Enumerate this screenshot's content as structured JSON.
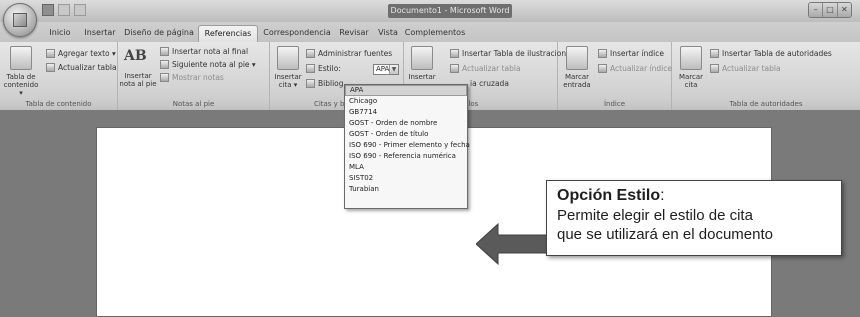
{
  "window": {
    "title": "Documento1 - Microsoft Word",
    "controls": [
      "–",
      "□",
      "✕"
    ]
  },
  "tabs": [
    {
      "label": "Inicio",
      "active": false
    },
    {
      "label": "Insertar",
      "active": false
    },
    {
      "label": "Diseño de página",
      "active": false
    },
    {
      "label": "Referencias",
      "active": true
    },
    {
      "label": "Correspondencia",
      "active": false
    },
    {
      "label": "Revisar",
      "active": false
    },
    {
      "label": "Vista",
      "active": false
    },
    {
      "label": "Complementos",
      "active": false
    }
  ],
  "ribbon": {
    "contenido": {
      "big_label_1": "Tabla de",
      "big_label_2": "contenido ▾",
      "agregar": "Agregar texto ▾",
      "actualizar": "Actualizar tabla",
      "group_label": "Tabla de contenido"
    },
    "notas": {
      "ab_glyph": "AB",
      "insertar_1": "Insertar",
      "insertar_2": "nota al pie",
      "insertar_final": "Insertar nota al final",
      "siguiente": "Siguiente nota al pie ▾",
      "mostrar": "Mostrar notas",
      "group_label": "Notas al pie"
    },
    "citas": {
      "insertar_1": "Insertar",
      "insertar_2": "cita ▾",
      "administrar": "Administrar fuentes",
      "estilo_label": "Estilo:",
      "estilo_value": "APA",
      "bibliografia": "Bibliog",
      "group_label": "Citas y biblio"
    },
    "titulos": {
      "insertar_1": "Insertar",
      "insertar_tabla": "Insertar Tabla de ilustraciones",
      "actualizar": "Actualizar tabla",
      "cruzada": "ia cruzada",
      "group_label": "ulos"
    },
    "indice": {
      "marcar_1": "Marcar",
      "marcar_2": "entrada",
      "insertar": "Insertar índice",
      "actualizar": "Actualizar índice",
      "group_label": "Índice"
    },
    "autoridades": {
      "marcar_1": "Marcar",
      "marcar_2": "cita",
      "insertar": "Insertar Tabla de autoridades",
      "actualizar": "Actualizar tabla",
      "group_label": "Tabla de autoridades"
    }
  },
  "style_dropdown": {
    "selected": "APA",
    "items": [
      "APA",
      "Chicago",
      "GB7714",
      "GOST - Orden de nombre",
      "GOST - Orden de título",
      "ISO 690 - Primer elemento y fecha",
      "ISO 690 - Referencia numérica",
      "MLA",
      "SIST02",
      "Turabian"
    ]
  },
  "callout": {
    "title": "Opción Estilo",
    "colon": ":",
    "line1": "Permite elegir el estilo de cita",
    "line2": "que se utilizará en el documento"
  }
}
